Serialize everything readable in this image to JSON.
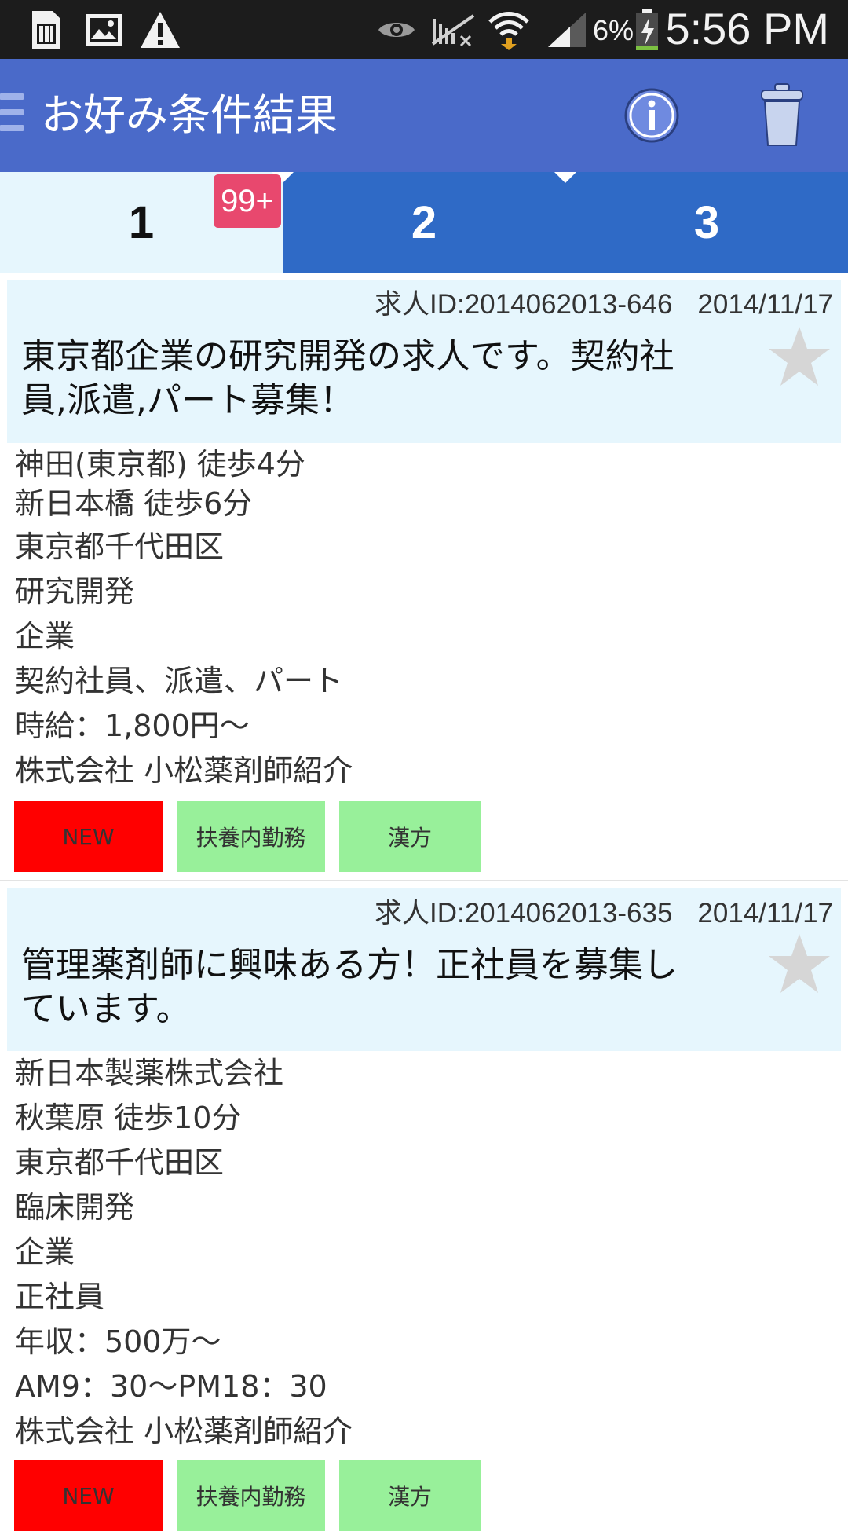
{
  "status_bar": {
    "time": "5:56 PM",
    "battery": "6%",
    "left_icons": [
      "sim-card-icon",
      "image-icon",
      "warning-icon"
    ],
    "right_icons": [
      "eye-icon",
      "no-signal-icon",
      "wifi-icon",
      "cell-signal-icon",
      "battery-charging-icon"
    ]
  },
  "app_bar": {
    "title": "お好み条件結果",
    "actions": [
      "info-icon",
      "trash-icon"
    ]
  },
  "tabs": [
    {
      "label": "1",
      "selected": true,
      "badge": "99+"
    },
    {
      "label": "2",
      "selected": false
    },
    {
      "label": "3",
      "selected": false
    }
  ],
  "colors": {
    "status_bar": "#1c1c1c",
    "app_bar": "#4a6ac9",
    "tab_selected": "#e6f6fd",
    "tab_unselected": "#2f6ac6",
    "badge": "#e8486e",
    "card_header": "#e6f6fd",
    "tag_new": "#ff0000",
    "tag_green": "#98f09a"
  },
  "jobs": [
    {
      "id": "求人ID:2014062013-646",
      "date": "2014/11/17",
      "title": "東京都企業の研究開発の求人です。契約社員,派遣,パート募集！",
      "title_lines": [
        "東京都企業の研究開発の求人です。契約社",
        "員,派遣,パート募集！"
      ],
      "details": [
        "神田(東京都) 徒歩4分",
        "新日本橋 徒歩6分",
        "東京都千代田区",
        "研究開発",
        "企業",
        "契約社員、派遣、パート",
        "時給：1,800円～",
        "株式会社 小松薬剤師紹介"
      ],
      "tags": [
        "NEW",
        "扶養内勤務",
        "漢方"
      ],
      "favorite": false
    },
    {
      "id": "求人ID:2014062013-635",
      "date": "2014/11/17",
      "title": "管理薬剤師に興味ある方！正社員を募集しています。",
      "title_lines": [
        "管理薬剤師に興味ある方！正社員を募集し",
        "ています。"
      ],
      "details": [
        "新日本製薬株式会社",
        "秋葉原 徒歩10分",
        "東京都千代田区",
        "臨床開発",
        "企業",
        "正社員",
        "年収：500万～",
        "AM9：30～PM18：30",
        "株式会社 小松薬剤師紹介"
      ],
      "tags": [
        "NEW",
        "扶養内勤務",
        "漢方"
      ],
      "favorite": false
    }
  ]
}
